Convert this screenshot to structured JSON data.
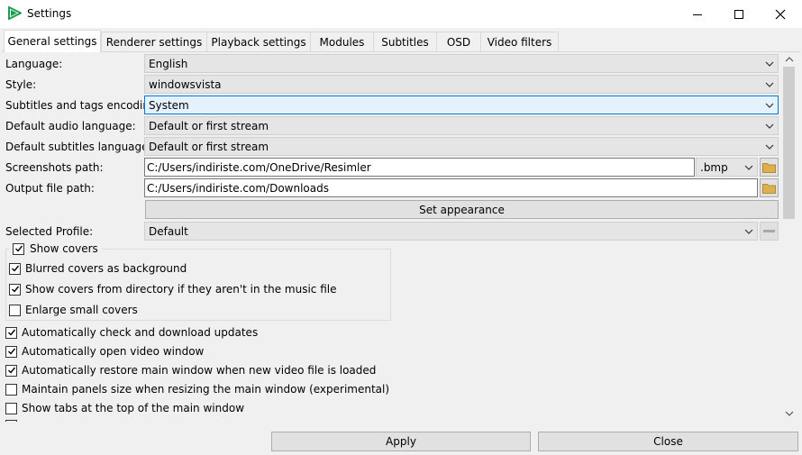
{
  "window": {
    "title": "Settings",
    "icon": "play-icon"
  },
  "window_controls": {
    "minimize": "minimize-icon",
    "maximize": "maximize-icon",
    "close": "close-icon"
  },
  "tabs": [
    {
      "label": "General settings",
      "active": true
    },
    {
      "label": "Renderer settings"
    },
    {
      "label": "Playback settings"
    },
    {
      "label": "Modules"
    },
    {
      "label": "Subtitles"
    },
    {
      "label": "OSD"
    },
    {
      "label": "Video filters"
    }
  ],
  "form": {
    "language": {
      "label": "Language:",
      "value": "English"
    },
    "style": {
      "label": "Style:",
      "value": "windowsvista"
    },
    "encoding": {
      "label": "Subtitles and tags encoding:",
      "value": "System"
    },
    "audio_lang": {
      "label": "Default audio language:",
      "value": "Default or first stream"
    },
    "sub_lang": {
      "label": "Default subtitles language:",
      "value": "Default or first stream"
    },
    "screenshots": {
      "label": "Screenshots path:",
      "value": "C:/Users/indiriste.com/OneDrive/Resimler",
      "format": ".bmp"
    },
    "output": {
      "label": "Output file path:",
      "value": "C:/Users/indiriste.com/Downloads"
    },
    "set_appearance": "Set appearance",
    "profile": {
      "label": "Selected Profile:",
      "value": "Default"
    }
  },
  "covers": {
    "group_label": "Show covers",
    "group_checked": true,
    "options": [
      {
        "label": "Blurred covers as background",
        "checked": true
      },
      {
        "label": "Show covers from directory if they aren't in the music file",
        "checked": true
      },
      {
        "label": "Enlarge small covers",
        "checked": false
      }
    ]
  },
  "options": [
    {
      "label": "Automatically check and download updates",
      "checked": true
    },
    {
      "label": "Automatically open video window",
      "checked": true
    },
    {
      "label": "Automatically restore main window when new video file is loaded",
      "checked": true
    },
    {
      "label": "Maintain panels size when resizing the main window (experimental)",
      "checked": false
    },
    {
      "label": "Show tabs at the top of the main window",
      "checked": false
    }
  ],
  "footer": {
    "apply": "Apply",
    "close": "Close"
  },
  "colors": {
    "accent": "#0078d7",
    "app_icon": "#1e9e4f",
    "folder": "#dcb04c"
  },
  "scrollbar": {
    "thumb_fraction": 0.41
  }
}
